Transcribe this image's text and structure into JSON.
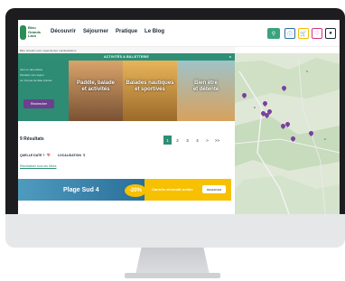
{
  "header": {
    "logo_text": "Bleu\nGrands\nLacs",
    "nav": [
      "Découvrir",
      "Séjourner",
      "Pratique",
      "Le Blog"
    ],
    "breadcrumb": "Bleu Grands Lacs  |  Agenda des manifestations"
  },
  "banner": {
    "label": "ACTIVITÉS & BILLETTERIE",
    "close": "x"
  },
  "search_panel": {
    "lines": [
      "Jour ou des places",
      "Pendant mon séjour",
      "Je n'ai pas de date précise"
    ],
    "button": "Rechercher"
  },
  "photos": [
    {
      "caption": "Paddle, balade\net activités"
    },
    {
      "caption": "Balades nautiques\net sportives"
    },
    {
      "caption": "Bien être\net détente"
    }
  ],
  "results": {
    "title": "9 Résultats",
    "pages": [
      "1",
      "2",
      "3",
      "4",
      ">",
      ">>"
    ]
  },
  "filters": {
    "date": "QUELLE DATE ?",
    "location": "LOCALISATION",
    "reset": "Réinitialiser tous les filtres"
  },
  "promo": {
    "title": "Plage Sud 4",
    "percent": "-20%",
    "right_text": "Carnets viennoitt online",
    "button": "RESERVER"
  },
  "colors": {
    "brand": "#2f8f74",
    "accent": "#6d3f8f",
    "promo_yellow": "#f7c000"
  }
}
